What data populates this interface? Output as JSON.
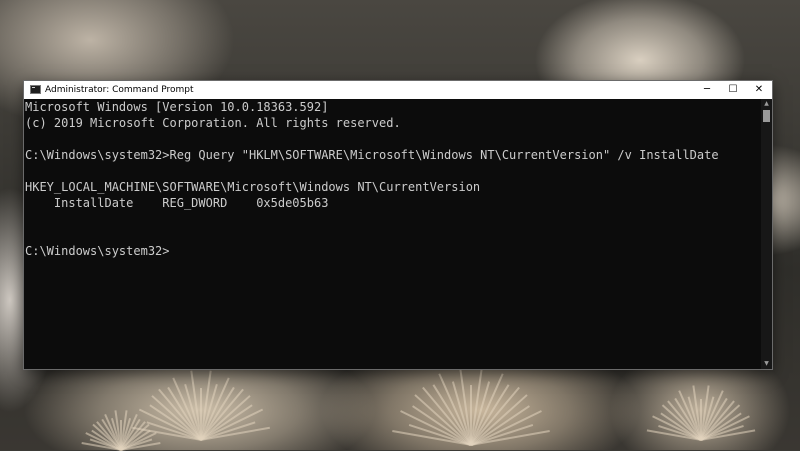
{
  "window": {
    "title": "Administrator: Command Prompt",
    "minimize_glyph": "─",
    "maximize_glyph": "☐",
    "close_glyph": "✕",
    "icon": "cmd-icon"
  },
  "console": {
    "background": "#0c0c0c",
    "foreground": "#cccccc",
    "lines": [
      "Microsoft Windows [Version 10.0.18363.592]",
      "(c) 2019 Microsoft Corporation. All rights reserved.",
      "C:\\Windows\\system32>Reg Query \"HKLM\\SOFTWARE\\Microsoft\\Windows NT\\CurrentVersion\" /v InstallDate",
      "HKEY_LOCAL_MACHINE\\SOFTWARE\\Microsoft\\Windows NT\\CurrentVersion",
      "    InstallDate    REG_DWORD    0x5de05b63",
      "C:\\Windows\\system32>"
    ]
  },
  "scrollbar": {
    "up_glyph": "▲",
    "down_glyph": "▼"
  }
}
